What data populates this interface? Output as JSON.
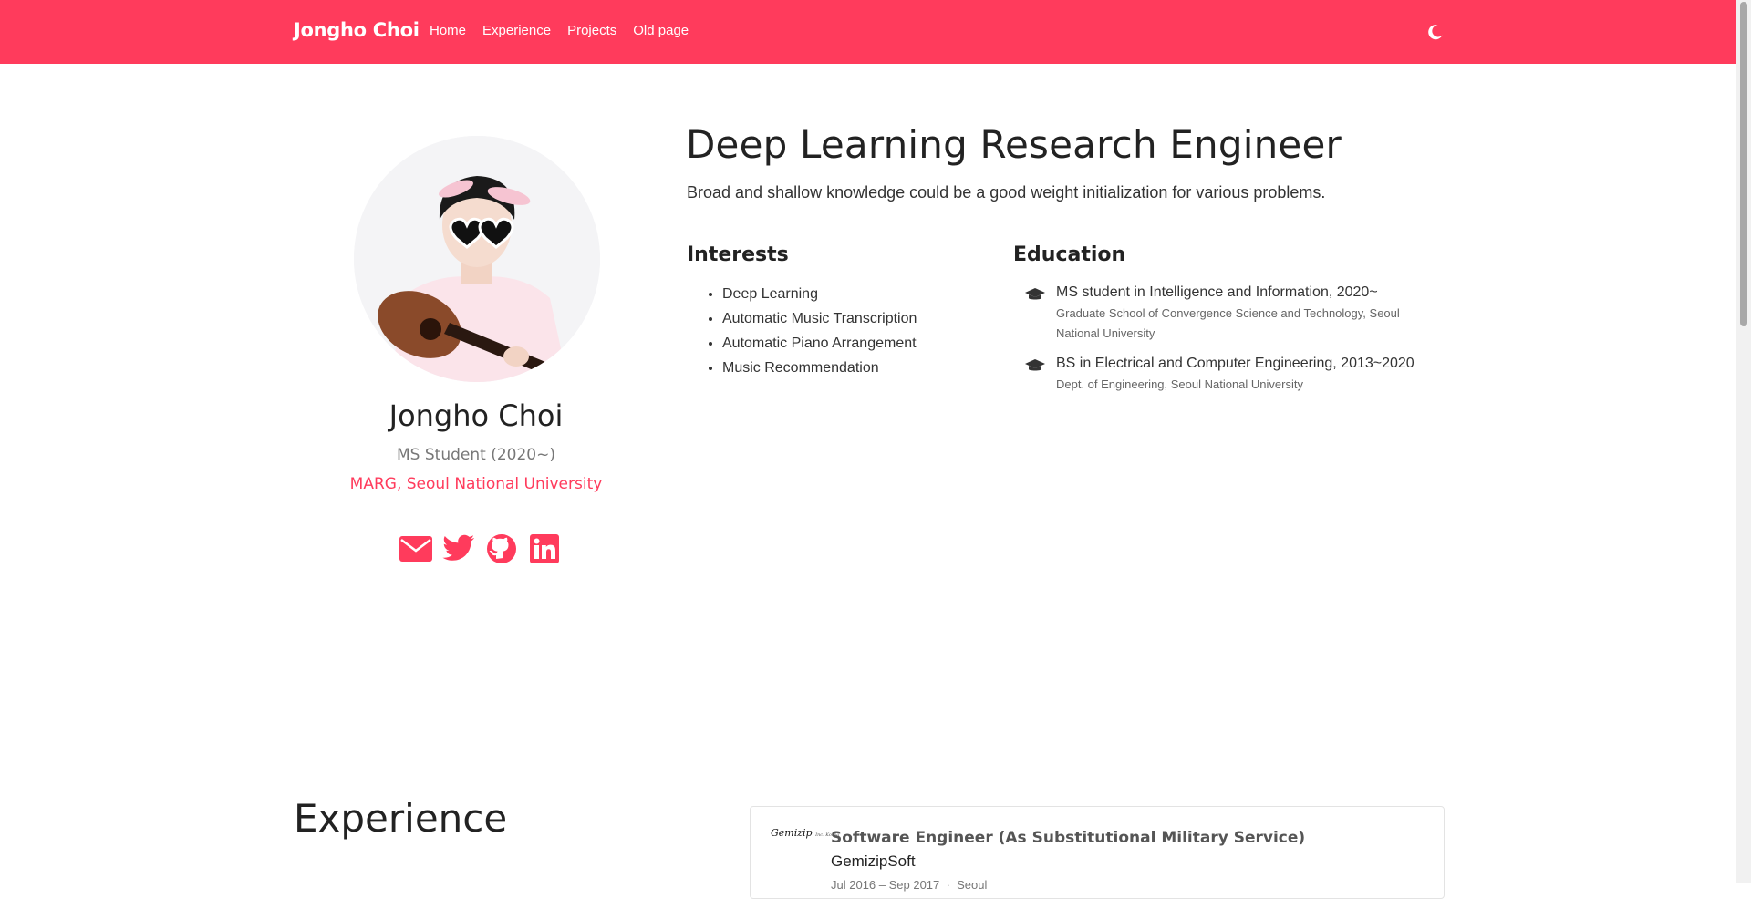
{
  "navbar": {
    "brand": "Jongho Choi",
    "links": [
      "Home",
      "Experience",
      "Projects",
      "Old page"
    ],
    "theme_toggle_icon": "moon-icon",
    "background_color": "#ff3b5c"
  },
  "profile": {
    "name": "Jongho Choi",
    "role": "MS Student (2020~)",
    "organization": "MARG, Seoul National University",
    "social_icons": [
      "envelope-icon",
      "twitter-icon",
      "github-icon",
      "linkedin-icon"
    ],
    "accent_color": "#ff3b5c"
  },
  "intro": {
    "title": "Deep Learning Research Engineer",
    "subtitle": "Broad and shallow knowledge could be a good weight initialization for various problems.",
    "interests_heading": "Interests",
    "interests": [
      "Deep Learning",
      "Automatic Music Transcription",
      "Automatic Piano Arrangement",
      "Music Recommendation"
    ],
    "education_heading": "Education",
    "education": [
      {
        "course": "MS student in Intelligence and Information, 2020~",
        "institution": "Graduate School of Convergence Science and Technology, Seoul National University"
      },
      {
        "course": "BS in Electrical and Computer Engineering, 2013~2020",
        "institution": "Dept. of Engineering, Seoul National University"
      }
    ]
  },
  "experience": {
    "heading": "Experience",
    "items": [
      {
        "logo_text": "Gemizip",
        "logo_subtext": "Inc. Korea",
        "role": "Software Engineer (As Substitutional Military Service)",
        "company": "GemizipSoft",
        "dates": "Jul 2016 – Sep 2017",
        "separator": "·",
        "location": "Seoul"
      }
    ]
  }
}
